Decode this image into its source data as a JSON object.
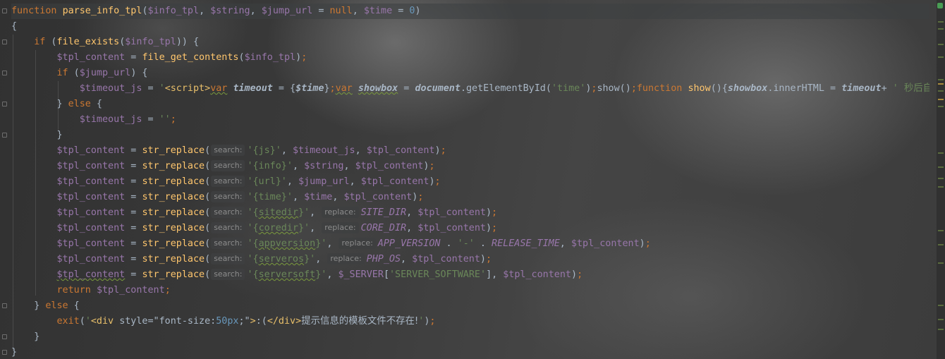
{
  "editor": {
    "language": "PHP",
    "theme": "Darcula",
    "background_image": "cat photo"
  },
  "code_lines": [
    [
      {
        "t": "function",
        "c": "kw"
      },
      {
        "t": " "
      },
      {
        "t": "parse_info_tpl",
        "c": "fn"
      },
      {
        "t": "("
      },
      {
        "t": "$info_tpl",
        "c": "var"
      },
      {
        "t": ", "
      },
      {
        "t": "$string",
        "c": "var"
      },
      {
        "t": ", "
      },
      {
        "t": "$jump_url",
        "c": "var"
      },
      {
        "t": " = "
      },
      {
        "t": "null",
        "c": "kw"
      },
      {
        "t": ", "
      },
      {
        "t": "$time",
        "c": "var"
      },
      {
        "t": " = "
      },
      {
        "t": "0",
        "c": "num"
      },
      {
        "t": ")"
      }
    ],
    [
      {
        "t": "{"
      }
    ],
    [
      {
        "t": "    "
      },
      {
        "t": "if",
        "c": "kw"
      },
      {
        "t": " ("
      },
      {
        "t": "file_exists",
        "c": "fn"
      },
      {
        "t": "("
      },
      {
        "t": "$info_tpl",
        "c": "var"
      },
      {
        "t": ")) {"
      }
    ],
    [
      {
        "t": "        "
      },
      {
        "t": "$tpl_content",
        "c": "var"
      },
      {
        "t": " = "
      },
      {
        "t": "file_get_contents",
        "c": "fn"
      },
      {
        "t": "("
      },
      {
        "t": "$info_tpl",
        "c": "var"
      },
      {
        "t": ")"
      },
      {
        "t": ";",
        "c": "kw"
      }
    ],
    [
      {
        "t": "        "
      },
      {
        "t": "if",
        "c": "kw"
      },
      {
        "t": " ("
      },
      {
        "t": "$jump_url",
        "c": "var"
      },
      {
        "t": ") {"
      }
    ],
    [
      {
        "t": "            "
      },
      {
        "t": "$timeout_js",
        "c": "var"
      },
      {
        "t": " = "
      },
      {
        "t": "'",
        "c": "str"
      },
      {
        "t": "<script>",
        "c": "tag"
      },
      {
        "t": "var",
        "c": "kw wave"
      },
      {
        "t": " "
      },
      {
        "t": "timeout",
        "c": "jsv"
      },
      {
        "t": " = {"
      },
      {
        "t": "$time",
        "c": "jsv"
      },
      {
        "t": "}"
      },
      {
        "t": ";",
        "c": "kw"
      },
      {
        "t": "var",
        "c": "kw wave"
      },
      {
        "t": " "
      },
      {
        "t": "showbox",
        "c": "jsv wave"
      },
      {
        "t": " = "
      },
      {
        "t": "document",
        "c": "jsv"
      },
      {
        "t": ".getElementById("
      },
      {
        "t": "'time'",
        "c": "str"
      },
      {
        "t": ")"
      },
      {
        "t": ";",
        "c": "kw"
      },
      {
        "t": "show()"
      },
      {
        "t": ";",
        "c": "kw"
      },
      {
        "t": "function",
        "c": "kw"
      },
      {
        "t": " "
      },
      {
        "t": "show",
        "c": "fn"
      },
      {
        "t": "(){"
      },
      {
        "t": "showbox",
        "c": "jsv"
      },
      {
        "t": ".innerHTML = "
      },
      {
        "t": "timeout",
        "c": "jsv"
      },
      {
        "t": "+ "
      },
      {
        "t": "' ",
        "c": "str"
      },
      {
        "t": "秒后自动跳转",
        "c": "str cjk"
      }
    ],
    [
      {
        "t": "        } "
      },
      {
        "t": "else",
        "c": "kw"
      },
      {
        "t": " {"
      }
    ],
    [
      {
        "t": "            "
      },
      {
        "t": "$timeout_js",
        "c": "var"
      },
      {
        "t": " = "
      },
      {
        "t": "''",
        "c": "str"
      },
      {
        "t": ";",
        "c": "kw"
      }
    ],
    [
      {
        "t": "        }"
      }
    ],
    [
      {
        "t": "        "
      },
      {
        "t": "$tpl_content",
        "c": "var"
      },
      {
        "t": " = "
      },
      {
        "t": "str_replace",
        "c": "fn"
      },
      {
        "t": "("
      },
      {
        "t": "search:",
        "h": 1
      },
      {
        "t": "'{js}'",
        "c": "str"
      },
      {
        "t": ", "
      },
      {
        "t": "$timeout_js",
        "c": "var"
      },
      {
        "t": ", "
      },
      {
        "t": "$tpl_content",
        "c": "var"
      },
      {
        "t": ")"
      },
      {
        "t": ";",
        "c": "kw"
      }
    ],
    [
      {
        "t": "        "
      },
      {
        "t": "$tpl_content",
        "c": "var"
      },
      {
        "t": " = "
      },
      {
        "t": "str_replace",
        "c": "fn"
      },
      {
        "t": "("
      },
      {
        "t": "search:",
        "h": 1
      },
      {
        "t": "'{info}'",
        "c": "str"
      },
      {
        "t": ", "
      },
      {
        "t": "$string",
        "c": "var"
      },
      {
        "t": ", "
      },
      {
        "t": "$tpl_content",
        "c": "var"
      },
      {
        "t": ")"
      },
      {
        "t": ";",
        "c": "kw"
      }
    ],
    [
      {
        "t": "        "
      },
      {
        "t": "$tpl_content",
        "c": "var"
      },
      {
        "t": " = "
      },
      {
        "t": "str_replace",
        "c": "fn"
      },
      {
        "t": "("
      },
      {
        "t": "search:",
        "h": 1
      },
      {
        "t": "'{url}'",
        "c": "str"
      },
      {
        "t": ", "
      },
      {
        "t": "$jump_url",
        "c": "var"
      },
      {
        "t": ", "
      },
      {
        "t": "$tpl_content",
        "c": "var"
      },
      {
        "t": ")"
      },
      {
        "t": ";",
        "c": "kw"
      }
    ],
    [
      {
        "t": "        "
      },
      {
        "t": "$tpl_content",
        "c": "var"
      },
      {
        "t": " = "
      },
      {
        "t": "str_replace",
        "c": "fn"
      },
      {
        "t": "("
      },
      {
        "t": "search:",
        "h": 1
      },
      {
        "t": "'{time}'",
        "c": "str"
      },
      {
        "t": ", "
      },
      {
        "t": "$time",
        "c": "var"
      },
      {
        "t": ", "
      },
      {
        "t": "$tpl_content",
        "c": "var"
      },
      {
        "t": ")"
      },
      {
        "t": ";",
        "c": "kw"
      }
    ],
    [
      {
        "t": "        "
      },
      {
        "t": "$tpl_content",
        "c": "var"
      },
      {
        "t": " = "
      },
      {
        "t": "str_replace",
        "c": "fn"
      },
      {
        "t": "("
      },
      {
        "t": "search:",
        "h": 1
      },
      {
        "t": "'{",
        "c": "str"
      },
      {
        "t": "sitedir",
        "c": "str wave"
      },
      {
        "t": "}'",
        "c": "str"
      },
      {
        "t": ", "
      },
      {
        "t": "replace:",
        "h": 1
      },
      {
        "t": "SITE_DIR",
        "c": "con"
      },
      {
        "t": ", "
      },
      {
        "t": "$tpl_content",
        "c": "var"
      },
      {
        "t": ")"
      },
      {
        "t": ";",
        "c": "kw"
      }
    ],
    [
      {
        "t": "        "
      },
      {
        "t": "$tpl_content",
        "c": "var"
      },
      {
        "t": " = "
      },
      {
        "t": "str_replace",
        "c": "fn"
      },
      {
        "t": "("
      },
      {
        "t": "search:",
        "h": 1
      },
      {
        "t": "'{",
        "c": "str"
      },
      {
        "t": "coredir",
        "c": "str wave"
      },
      {
        "t": "}'",
        "c": "str"
      },
      {
        "t": ", "
      },
      {
        "t": "replace:",
        "h": 1
      },
      {
        "t": "CORE_DIR",
        "c": "con"
      },
      {
        "t": ", "
      },
      {
        "t": "$tpl_content",
        "c": "var"
      },
      {
        "t": ")"
      },
      {
        "t": ";",
        "c": "kw"
      }
    ],
    [
      {
        "t": "        "
      },
      {
        "t": "$tpl_content",
        "c": "var"
      },
      {
        "t": " = "
      },
      {
        "t": "str_replace",
        "c": "fn"
      },
      {
        "t": "("
      },
      {
        "t": "search:",
        "h": 1
      },
      {
        "t": "'{",
        "c": "str"
      },
      {
        "t": "appversion",
        "c": "str wave"
      },
      {
        "t": "}'",
        "c": "str"
      },
      {
        "t": ", "
      },
      {
        "t": "replace:",
        "h": 1
      },
      {
        "t": "APP_VERSION",
        "c": "con"
      },
      {
        "t": " . "
      },
      {
        "t": "'-'",
        "c": "str"
      },
      {
        "t": " . "
      },
      {
        "t": "RELEASE_TIME",
        "c": "con"
      },
      {
        "t": ", "
      },
      {
        "t": "$tpl_content",
        "c": "var"
      },
      {
        "t": ")"
      },
      {
        "t": ";",
        "c": "kw"
      }
    ],
    [
      {
        "t": "        "
      },
      {
        "t": "$tpl_content",
        "c": "var"
      },
      {
        "t": " = "
      },
      {
        "t": "str_replace",
        "c": "fn"
      },
      {
        "t": "("
      },
      {
        "t": "search:",
        "h": 1
      },
      {
        "t": "'{",
        "c": "str"
      },
      {
        "t": "serveros",
        "c": "str wave"
      },
      {
        "t": "}'",
        "c": "str"
      },
      {
        "t": ", "
      },
      {
        "t": "replace:",
        "h": 1
      },
      {
        "t": "PHP_OS",
        "c": "con"
      },
      {
        "t": ", "
      },
      {
        "t": "$tpl_content",
        "c": "var"
      },
      {
        "t": ")"
      },
      {
        "t": ";",
        "c": "kw"
      }
    ],
    [
      {
        "t": "        "
      },
      {
        "t": "$tpl_content",
        "c": "var wave"
      },
      {
        "t": " = "
      },
      {
        "t": "str_replace",
        "c": "fn"
      },
      {
        "t": "("
      },
      {
        "t": "search:",
        "h": 1
      },
      {
        "t": "'{",
        "c": "str"
      },
      {
        "t": "serversoft",
        "c": "str wave"
      },
      {
        "t": "}'",
        "c": "str"
      },
      {
        "t": ", "
      },
      {
        "t": "$_SERVER",
        "c": "var"
      },
      {
        "t": "["
      },
      {
        "t": "'SERVER_SOFTWARE'",
        "c": "str"
      },
      {
        "t": "], "
      },
      {
        "t": "$tpl_content",
        "c": "var"
      },
      {
        "t": ")"
      },
      {
        "t": ";",
        "c": "kw"
      }
    ],
    [
      {
        "t": "        "
      },
      {
        "t": "return",
        "c": "kw"
      },
      {
        "t": " "
      },
      {
        "t": "$tpl_content",
        "c": "var"
      },
      {
        "t": ";",
        "c": "kw"
      }
    ],
    [
      {
        "t": "    } "
      },
      {
        "t": "else",
        "c": "kw"
      },
      {
        "t": " {"
      }
    ],
    [
      {
        "t": "        "
      },
      {
        "t": "exit",
        "c": "kw"
      },
      {
        "t": "("
      },
      {
        "t": "'",
        "c": "str"
      },
      {
        "t": "<div ",
        "c": "tag"
      },
      {
        "t": "style",
        "c": "js"
      },
      {
        "t": "=\"font-size:"
      },
      {
        "t": "50px",
        "c": "num"
      },
      {
        "t": ";\""
      },
      {
        "t": ">",
        "c": "tag"
      },
      {
        "t": ":("
      },
      {
        "t": "</div>",
        "c": "tag"
      },
      {
        "t": "提示信息的模板文件不存在!",
        "c": "cjk"
      },
      {
        "t": "'",
        "c": "str"
      },
      {
        "t": ")"
      },
      {
        "t": ";",
        "c": "kw"
      }
    ],
    [
      {
        "t": "    }"
      }
    ],
    [
      {
        "t": "}"
      }
    ]
  ],
  "caret_line": 0
}
